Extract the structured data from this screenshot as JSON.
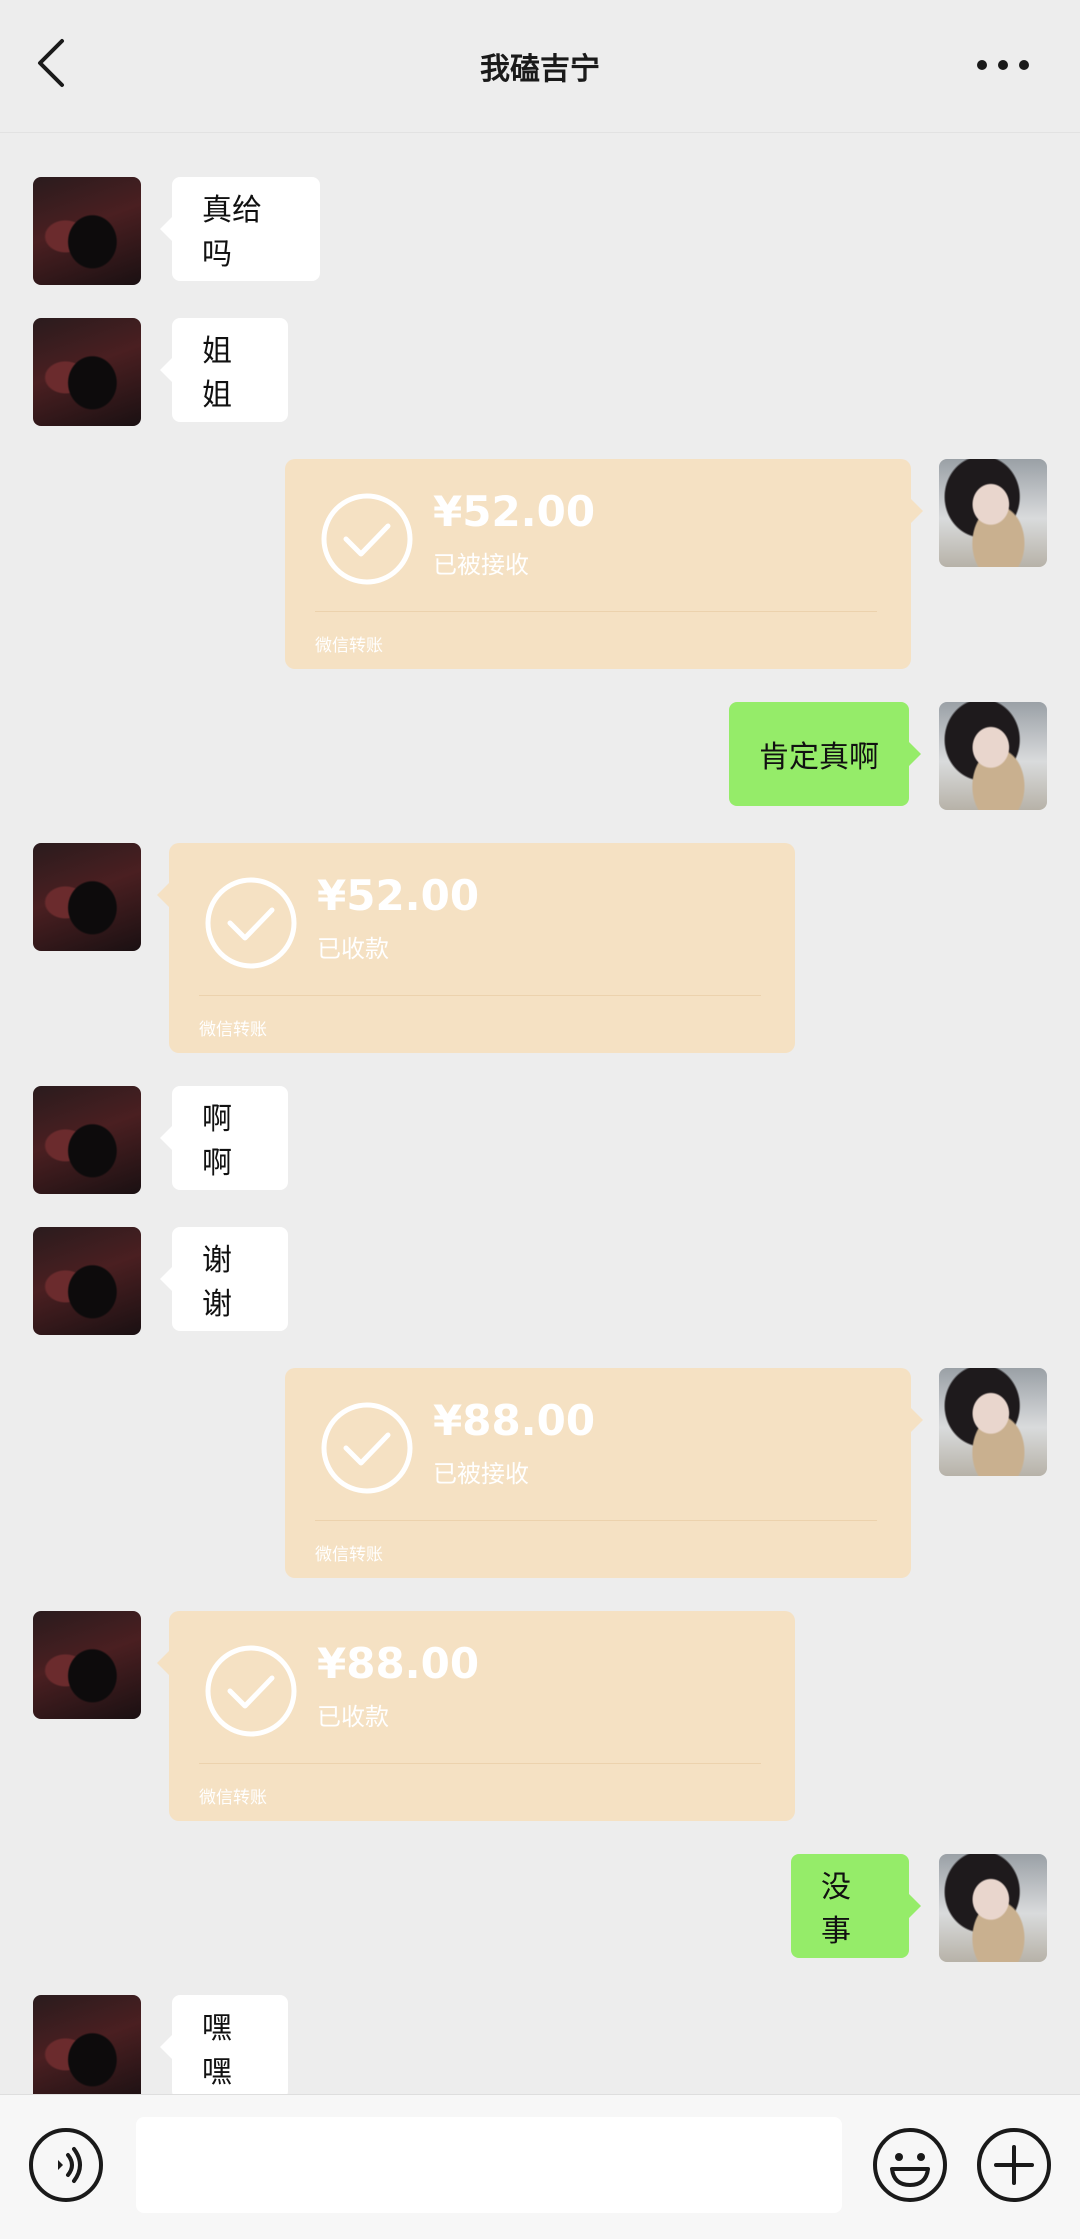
{
  "header": {
    "title": "我磕吉宁",
    "back_icon": "chevron-left-icon",
    "more_icon": "more-dots-icon"
  },
  "messages": [
    {
      "side": "left",
      "kind": "text",
      "text": "真给吗"
    },
    {
      "side": "left",
      "kind": "text",
      "text": "姐姐"
    },
    {
      "side": "right",
      "kind": "transfer",
      "amount": "¥52.00",
      "status": "已被接收",
      "brand": "微信转账"
    },
    {
      "side": "right",
      "kind": "text",
      "text": "肯定真啊"
    },
    {
      "side": "left",
      "kind": "transfer",
      "amount": "¥52.00",
      "status": "已收款",
      "brand": "微信转账"
    },
    {
      "side": "left",
      "kind": "text",
      "text": "啊啊"
    },
    {
      "side": "left",
      "kind": "text",
      "text": "谢谢"
    },
    {
      "side": "right",
      "kind": "transfer",
      "amount": "¥88.00",
      "status": "已被接收",
      "brand": "微信转账"
    },
    {
      "side": "left",
      "kind": "transfer",
      "amount": "¥88.00",
      "status": "已收款",
      "brand": "微信转账"
    },
    {
      "side": "right",
      "kind": "text",
      "text": "没事"
    },
    {
      "side": "left",
      "kind": "text",
      "text": "嘿嘿"
    }
  ],
  "input_bar": {
    "voice_icon": "voice-icon",
    "input_value": "",
    "emoji_icon": "emoji-icon",
    "plus_icon": "plus-circle-icon"
  },
  "colors": {
    "background": "#ededed",
    "self_bubble": "#95ec69",
    "other_bubble": "#ffffff",
    "transfer_card": "#f5e1c3"
  }
}
